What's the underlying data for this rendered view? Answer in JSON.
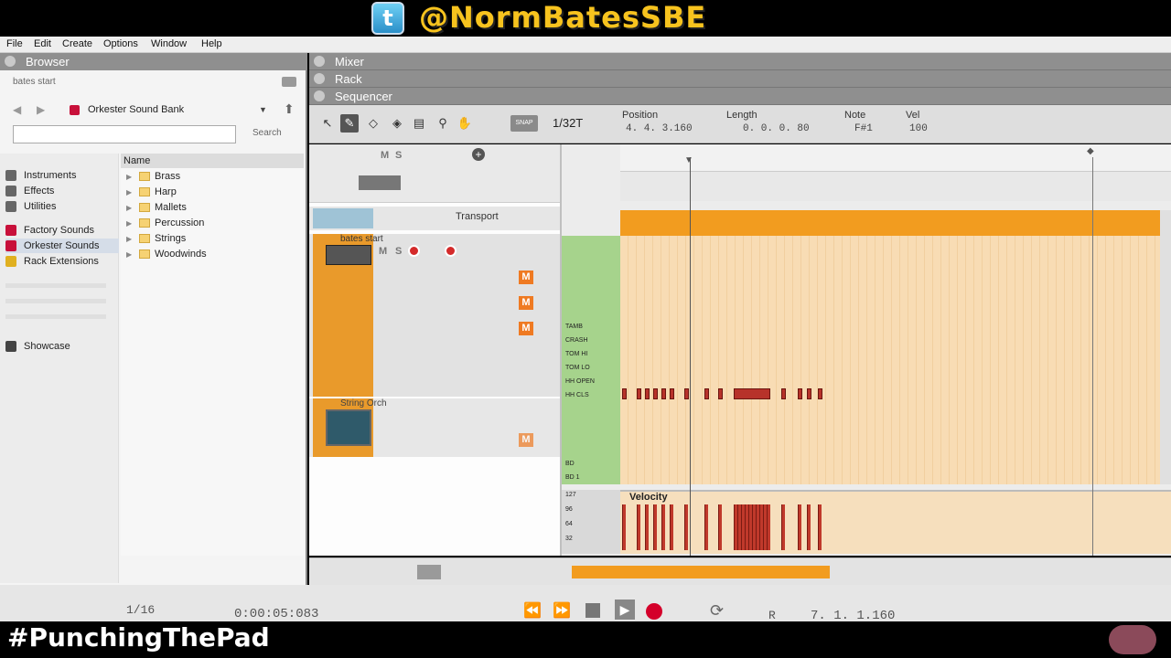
{
  "banner": {
    "handle": "@NormBatesSBE",
    "twitter_icon": "twitter-bird-icon"
  },
  "footer": {
    "hashtag": "#PunchingThePad",
    "logo_icon": "channel-logo-icon"
  },
  "menu": [
    "File",
    "Edit",
    "Create",
    "Options",
    "Window",
    "Help"
  ],
  "browser": {
    "title": "Browser",
    "location": "bates start",
    "sound_bank": "Orkester Sound Bank",
    "search_placeholder": "",
    "search_button": "Search",
    "places": [
      {
        "label": "Instruments",
        "icon": "instruments-icon"
      },
      {
        "label": "Effects",
        "icon": "effects-icon"
      },
      {
        "label": "Utilities",
        "icon": "utilities-icon"
      },
      {
        "label": "Factory Sounds",
        "icon": "factory-sounds-icon"
      },
      {
        "label": "Orkester Sounds",
        "icon": "orkester-sounds-icon",
        "selected": true
      },
      {
        "label": "Rack Extensions",
        "icon": "rack-extensions-icon"
      },
      {
        "label": "Showcase",
        "icon": "showcase-icon"
      }
    ],
    "column_header": "Name",
    "folders": [
      "Brass",
      "Harp",
      "Mallets",
      "Percussion",
      "Strings",
      "Woodwinds"
    ]
  },
  "panels": {
    "mixer": "Mixer",
    "rack": "Rack",
    "sequencer": "Sequencer"
  },
  "toolbar": {
    "snap": "SNAP",
    "quantize": "1/32T",
    "position_label": "Position",
    "position_value": "4. 4. 3.160",
    "length_label": "Length",
    "length_value": "0. 0. 0. 80",
    "note_label": "Note",
    "note_value": "F#1",
    "vel_label": "Vel",
    "vel_value": "100"
  },
  "tracks": {
    "transport_label": "Transport",
    "track1_name": "bates start",
    "track2_name": "String Orch",
    "mute": "M",
    "solo": "S"
  },
  "editor": {
    "velocity_label": "Velocity",
    "key_labels": [
      "TAMB",
      "CRASH",
      "TOM HI",
      "TOM LO",
      "HH OPEN",
      "HH CLS",
      "BD",
      "BD 1"
    ],
    "velocity_scale": [
      "127",
      "96",
      "64",
      "32"
    ]
  },
  "transport": {
    "quantize": "1/16",
    "time": "0:00:05:083",
    "position": "7. 1. 1.160",
    "r_label": "R"
  }
}
